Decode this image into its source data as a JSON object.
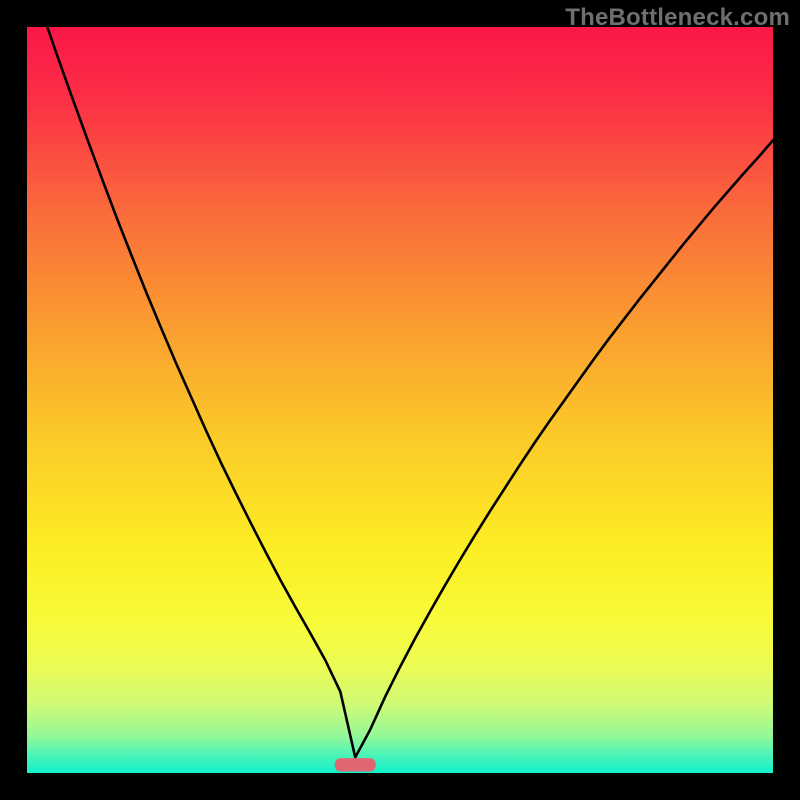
{
  "watermark": "TheBottleneck.com",
  "chart_data": {
    "type": "line",
    "title": "",
    "xlabel": "",
    "ylabel": "",
    "xlim": [
      0,
      1
    ],
    "ylim": [
      0,
      1
    ],
    "notes": "Bottleneck curve: V-shaped black curve descending from top-left, reaching zero near x≈0.44, then rising toward the right. Background is a vertical rainbow gradient (red→orange→yellow→green). A small rounded red pill marker sits at the curve minimum on the x-axis.",
    "series": [
      {
        "name": "bottleneck-curve",
        "x": [
          0.0,
          0.02,
          0.04,
          0.06,
          0.08,
          0.1,
          0.12,
          0.14,
          0.16,
          0.18,
          0.2,
          0.22,
          0.24,
          0.26,
          0.28,
          0.3,
          0.32,
          0.34,
          0.36,
          0.38,
          0.4,
          0.42,
          0.44,
          0.46,
          0.48,
          0.5,
          0.52,
          0.54,
          0.56,
          0.58,
          0.6,
          0.62,
          0.64,
          0.66,
          0.68,
          0.7,
          0.72,
          0.74,
          0.76,
          0.78,
          0.8,
          0.82,
          0.84,
          0.86,
          0.88,
          0.9,
          0.92,
          0.94,
          0.96,
          0.98,
          1.0
        ],
        "y": [
          1.08,
          1.021,
          0.963,
          0.907,
          0.852,
          0.798,
          0.745,
          0.694,
          0.644,
          0.596,
          0.549,
          0.504,
          0.459,
          0.416,
          0.375,
          0.335,
          0.296,
          0.258,
          0.222,
          0.187,
          0.151,
          0.109,
          0.021,
          0.058,
          0.102,
          0.142,
          0.18,
          0.216,
          0.251,
          0.285,
          0.318,
          0.35,
          0.381,
          0.412,
          0.442,
          0.471,
          0.499,
          0.527,
          0.555,
          0.582,
          0.608,
          0.634,
          0.659,
          0.684,
          0.709,
          0.733,
          0.757,
          0.78,
          0.803,
          0.825,
          0.848
        ]
      }
    ],
    "marker": {
      "x": 0.44,
      "width": 0.055,
      "height": 0.018,
      "color": "#e06671"
    },
    "gradient_stops": [
      {
        "offset": 0.0,
        "color": "#fb1748"
      },
      {
        "offset": 0.1,
        "color": "#fb3046"
      },
      {
        "offset": 0.25,
        "color": "#fa6c3b"
      },
      {
        "offset": 0.4,
        "color": "#fa9d30"
      },
      {
        "offset": 0.55,
        "color": "#fbca28"
      },
      {
        "offset": 0.7,
        "color": "#fcee24"
      },
      {
        "offset": 0.8,
        "color": "#f7fb3a"
      },
      {
        "offset": 0.86,
        "color": "#ebfb56"
      },
      {
        "offset": 0.91,
        "color": "#cdfa77"
      },
      {
        "offset": 0.95,
        "color": "#94f898"
      },
      {
        "offset": 0.975,
        "color": "#4df4b6"
      },
      {
        "offset": 1.0,
        "color": "#12f1cd"
      }
    ]
  }
}
